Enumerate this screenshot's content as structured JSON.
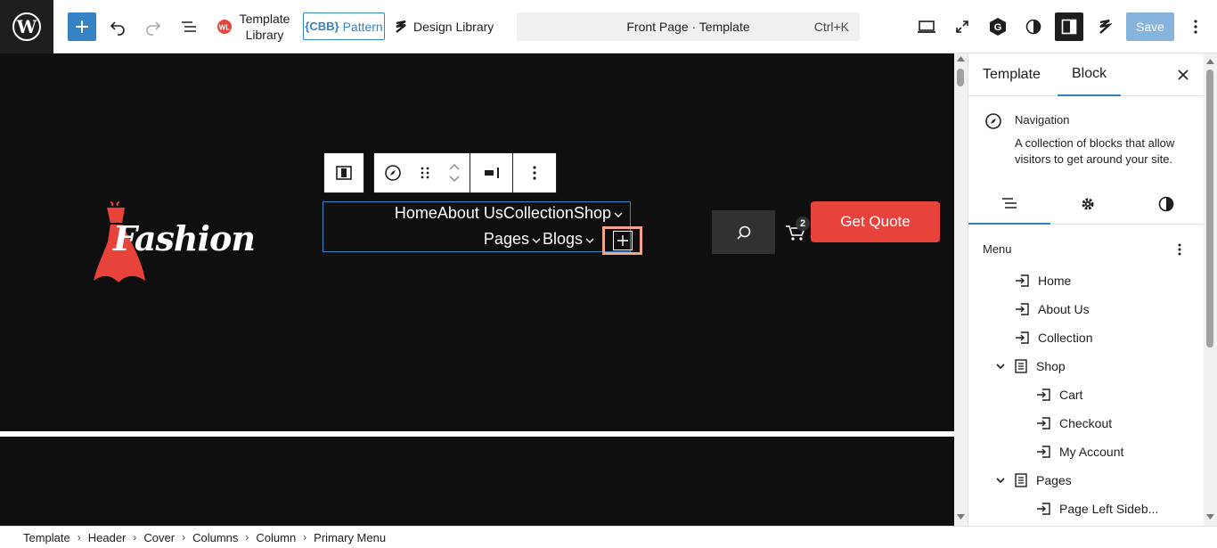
{
  "topbar": {
    "template_library_label": "Template Library",
    "cbb_mark": "{CBB}",
    "pattern_label": "Pattern",
    "design_library_label": "Design Library",
    "command_title": "Front Page · Template",
    "command_shortcut": "Ctrl+K",
    "save_label": "Save"
  },
  "canvas": {
    "logo_text": "Fashion",
    "nav_row1": [
      "Home",
      "About Us",
      "Collection",
      "Shop"
    ],
    "nav_row2": [
      "Pages",
      "Blogs"
    ],
    "cart_count": "2",
    "cta_label": "Get Quote"
  },
  "sidebar": {
    "tabs": [
      "Template",
      "Block"
    ],
    "block_name": "Navigation",
    "block_description": "A collection of blocks that allow visitors to get around your site.",
    "menu_label": "Menu",
    "menu_items": [
      {
        "label": "Home",
        "level": 0,
        "kind": "link"
      },
      {
        "label": "About Us",
        "level": 0,
        "kind": "link"
      },
      {
        "label": "Collection",
        "level": 0,
        "kind": "link"
      },
      {
        "label": "Shop",
        "level": 0,
        "kind": "submenu"
      },
      {
        "label": "Cart",
        "level": 1,
        "kind": "link"
      },
      {
        "label": "Checkout",
        "level": 1,
        "kind": "link"
      },
      {
        "label": "My Account",
        "level": 1,
        "kind": "link"
      },
      {
        "label": "Pages",
        "level": 0,
        "kind": "submenu"
      },
      {
        "label": "Page Left Sideb...",
        "level": 1,
        "kind": "link"
      }
    ]
  },
  "breadcrumb": [
    "Template",
    "Header",
    "Cover",
    "Columns",
    "Column",
    "Primary Menu"
  ],
  "colors": {
    "accent": "#3582c4",
    "cta": "#e8433b",
    "canvas_bg": "#0f0f0f",
    "highlight": "#f2a58c"
  }
}
